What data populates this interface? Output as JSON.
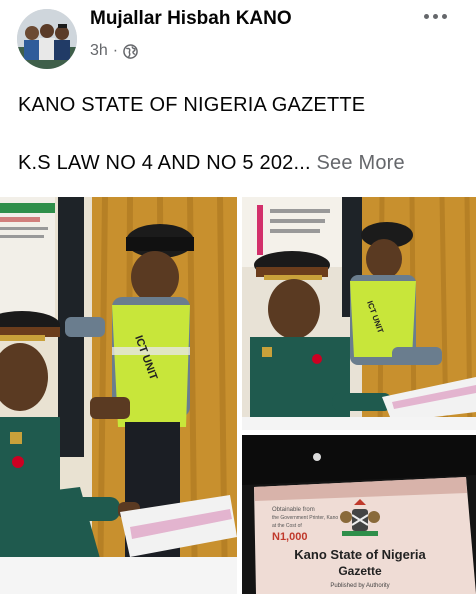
{
  "post": {
    "author": "Mujallar Hisbah KANO",
    "time": "3h",
    "separator": "·",
    "privacy_icon": "globe-icon",
    "menu_icon": "more-options-icon",
    "text_line1": "KANO STATE OF NIGERIA GAZETTE",
    "text_line2": "K.S LAW NO 4 AND NO 5 202...",
    "see_more": "See More"
  },
  "photos": {
    "vest_text": "ICT UNIT",
    "gazette": {
      "top_text_1": "Obtainable from",
      "top_text_2": "the Government Printer, Kano",
      "top_text_3": "at the Cost of",
      "price": "N1,000",
      "title_1": "Kano State of Nigeria",
      "title_2": "Gazette",
      "subtitle": "Published by Authority"
    }
  },
  "colors": {
    "secondary_text": "#65676b",
    "vest": "#c8e63a",
    "uniform": "#1f5a4e",
    "curtain": "#c8902e"
  }
}
